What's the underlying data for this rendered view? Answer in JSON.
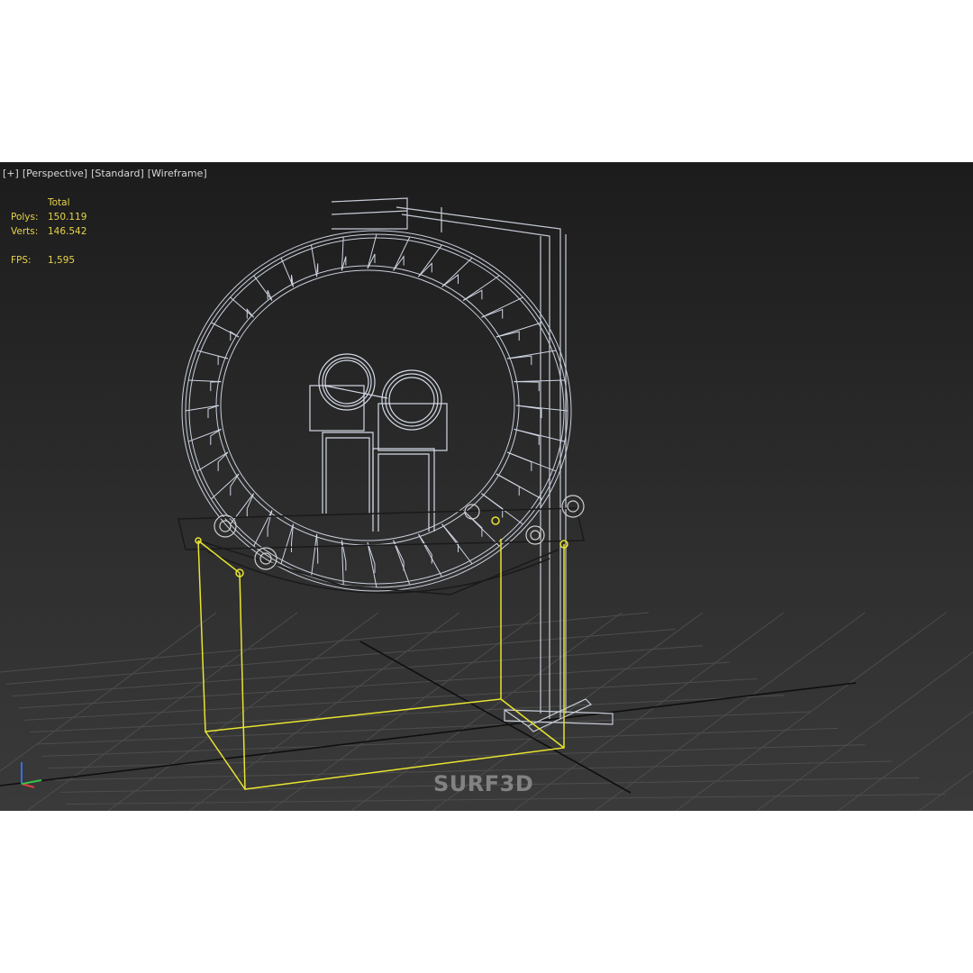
{
  "viewport": {
    "labels": [
      "[+]",
      "[Perspective]",
      "[Standard]",
      "[Wireframe]"
    ]
  },
  "stats": {
    "header": "Total",
    "polys_label": "Polys:",
    "polys_value": "150.119",
    "verts_label": "Verts:",
    "verts_value": "146.542",
    "fps_label": "FPS:",
    "fps_value": "1,595"
  },
  "watermark": "SURF3D",
  "colors": {
    "selection": "#e8e430",
    "wire": "#c9cfdd",
    "stats_text": "#e6d24a",
    "grid": "#4a4a4a"
  },
  "icons": [
    "axis-gizmo-icon"
  ]
}
